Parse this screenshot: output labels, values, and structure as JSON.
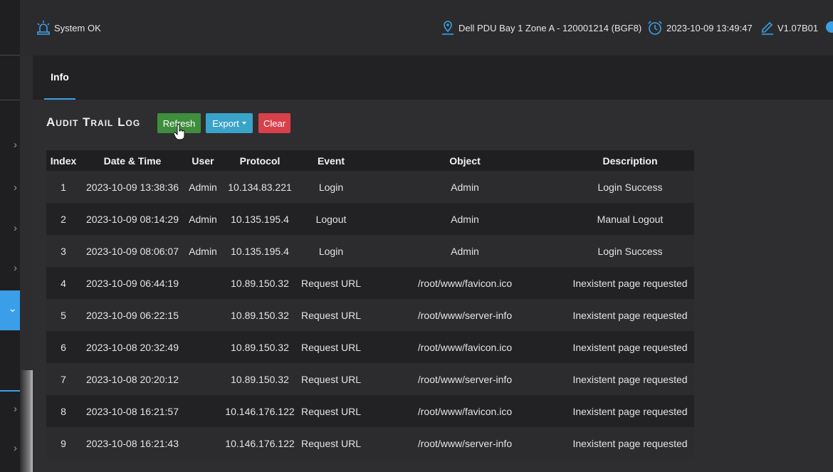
{
  "header": {
    "status": "System OK",
    "device": "Dell PDU Bay 1 Zone A - 120001214 (BGF8)",
    "datetime": "2023-10-09 13:49:47",
    "version": "V1.07B01"
  },
  "tabs": [
    {
      "label": "Info"
    }
  ],
  "section": {
    "title": "Audit Trail Log",
    "buttons": {
      "refresh": "Refresh",
      "export": "Export",
      "clear": "Clear"
    }
  },
  "table": {
    "columns": [
      "Index",
      "Date & Time",
      "User",
      "Protocol",
      "Event",
      "Object",
      "Description"
    ],
    "rows": [
      [
        "1",
        "2023-10-09 13:38:36",
        "Admin",
        "10.134.83.221",
        "Login",
        "Admin",
        "Login Success"
      ],
      [
        "2",
        "2023-10-09 08:14:29",
        "Admin",
        "10.135.195.4",
        "Logout",
        "Admin",
        "Manual Logout"
      ],
      [
        "3",
        "2023-10-09 08:06:07",
        "Admin",
        "10.135.195.4",
        "Login",
        "Admin",
        "Login Success"
      ],
      [
        "4",
        "2023-10-09 06:44:19",
        "",
        "10.89.150.32",
        "Request URL",
        "/root/www/favicon.ico",
        "Inexistent page requested"
      ],
      [
        "5",
        "2023-10-09 06:22:15",
        "",
        "10.89.150.32",
        "Request URL",
        "/root/www/server-info",
        "Inexistent page requested"
      ],
      [
        "6",
        "2023-10-08 20:32:49",
        "",
        "10.89.150.32",
        "Request URL",
        "/root/www/favicon.ico",
        "Inexistent page requested"
      ],
      [
        "7",
        "2023-10-08 20:20:12",
        "",
        "10.89.150.32",
        "Request URL",
        "/root/www/server-info",
        "Inexistent page requested"
      ],
      [
        "8",
        "2023-10-08 16:21:57",
        "",
        "10.146.176.122",
        "Request URL",
        "/root/www/favicon.ico",
        "Inexistent page requested"
      ],
      [
        "9",
        "2023-10-08 16:21:43",
        "",
        "10.146.176.122",
        "Request URL",
        "/root/www/server-info",
        "Inexistent page requested"
      ]
    ]
  },
  "icons": {
    "status": "alarm-light-icon",
    "device": "location-pin-icon",
    "datetime": "clock-sync-icon",
    "version": "pencil-icon"
  },
  "colors": {
    "accent": "#3aa0e6",
    "refresh": "#3e8e3e",
    "export": "#3aa3c9",
    "clear": "#d9404a"
  }
}
